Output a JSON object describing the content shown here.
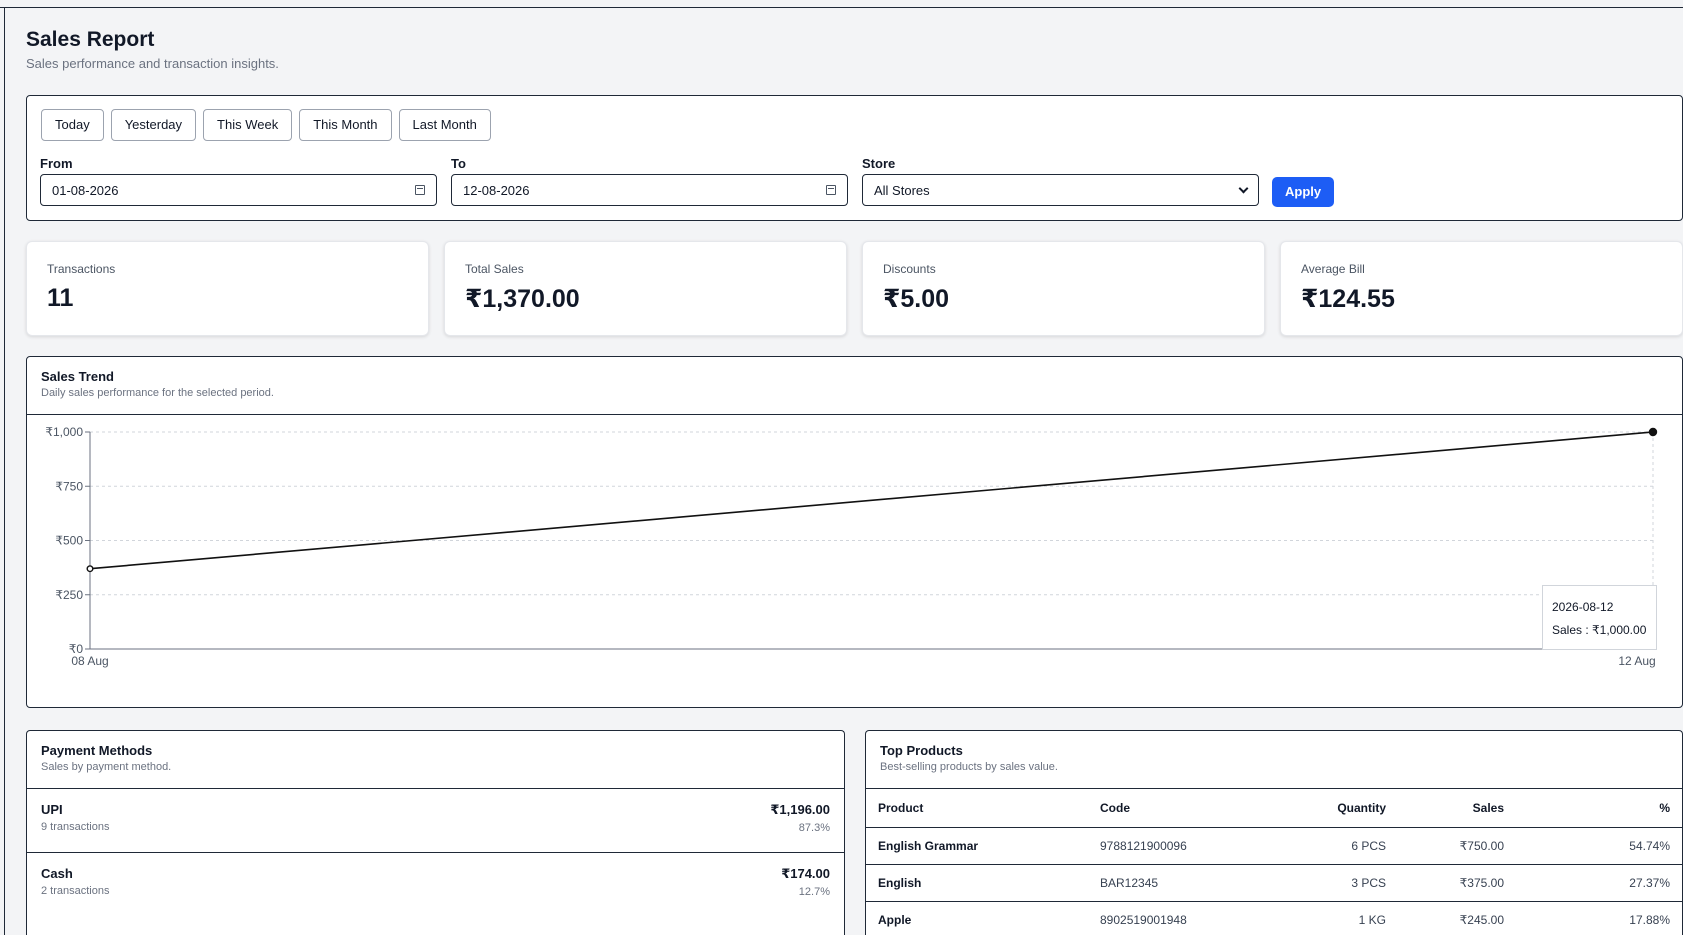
{
  "header": {
    "title": "Sales Report",
    "subtitle": "Sales performance and transaction insights."
  },
  "filters": {
    "quick_ranges": [
      "Today",
      "Yesterday",
      "This Week",
      "This Month",
      "Last Month"
    ],
    "from_label": "From",
    "from_value": "01-08-2026",
    "to_label": "To",
    "to_value": "12-08-2026",
    "store_label": "Store",
    "store_value": "All Stores",
    "apply_label": "Apply"
  },
  "stats": [
    {
      "label": "Transactions",
      "value": "11"
    },
    {
      "label": "Total Sales",
      "value": "₹1,370.00"
    },
    {
      "label": "Discounts",
      "value": "₹5.00"
    },
    {
      "label": "Average Bill",
      "value": "₹124.55"
    }
  ],
  "trend": {
    "title": "Sales Trend",
    "subtitle": "Daily sales performance for the selected period.",
    "tooltip_date": "2026-08-12",
    "tooltip_value": "Sales : ₹1,000.00"
  },
  "chart_data": {
    "type": "line",
    "x": [
      "08 Aug",
      "12 Aug"
    ],
    "series": [
      {
        "values": [
          370,
          1000
        ]
      }
    ],
    "y_ticks": [
      "₹0",
      "₹250",
      "₹500",
      "₹750",
      "₹1,000"
    ],
    "y_tick_values": [
      0,
      250,
      500,
      750,
      1000
    ],
    "ylim": [
      0,
      1000
    ],
    "grid": true,
    "line_color": "#111111"
  },
  "payments": {
    "title": "Payment Methods",
    "subtitle": "Sales by payment method.",
    "rows": [
      {
        "name": "UPI",
        "count": "9 transactions",
        "amount": "₹1,196.00",
        "percent": "87.3%"
      },
      {
        "name": "Cash",
        "count": "2 transactions",
        "amount": "₹174.00",
        "percent": "12.7%"
      }
    ]
  },
  "products": {
    "title": "Top Products",
    "subtitle": "Best-selling products by sales value.",
    "columns": [
      "Product",
      "Code",
      "Quantity",
      "Sales",
      "%"
    ],
    "rows": [
      [
        "English Grammar",
        "9788121900096",
        "6 PCS",
        "₹750.00",
        "54.74%"
      ],
      [
        "English",
        "BAR12345",
        "3 PCS",
        "₹375.00",
        "27.37%"
      ],
      [
        "Apple",
        "8902519001948",
        "1 KG",
        "₹245.00",
        "17.88%"
      ]
    ]
  },
  "colors": {
    "accent": "#1d5df5"
  }
}
